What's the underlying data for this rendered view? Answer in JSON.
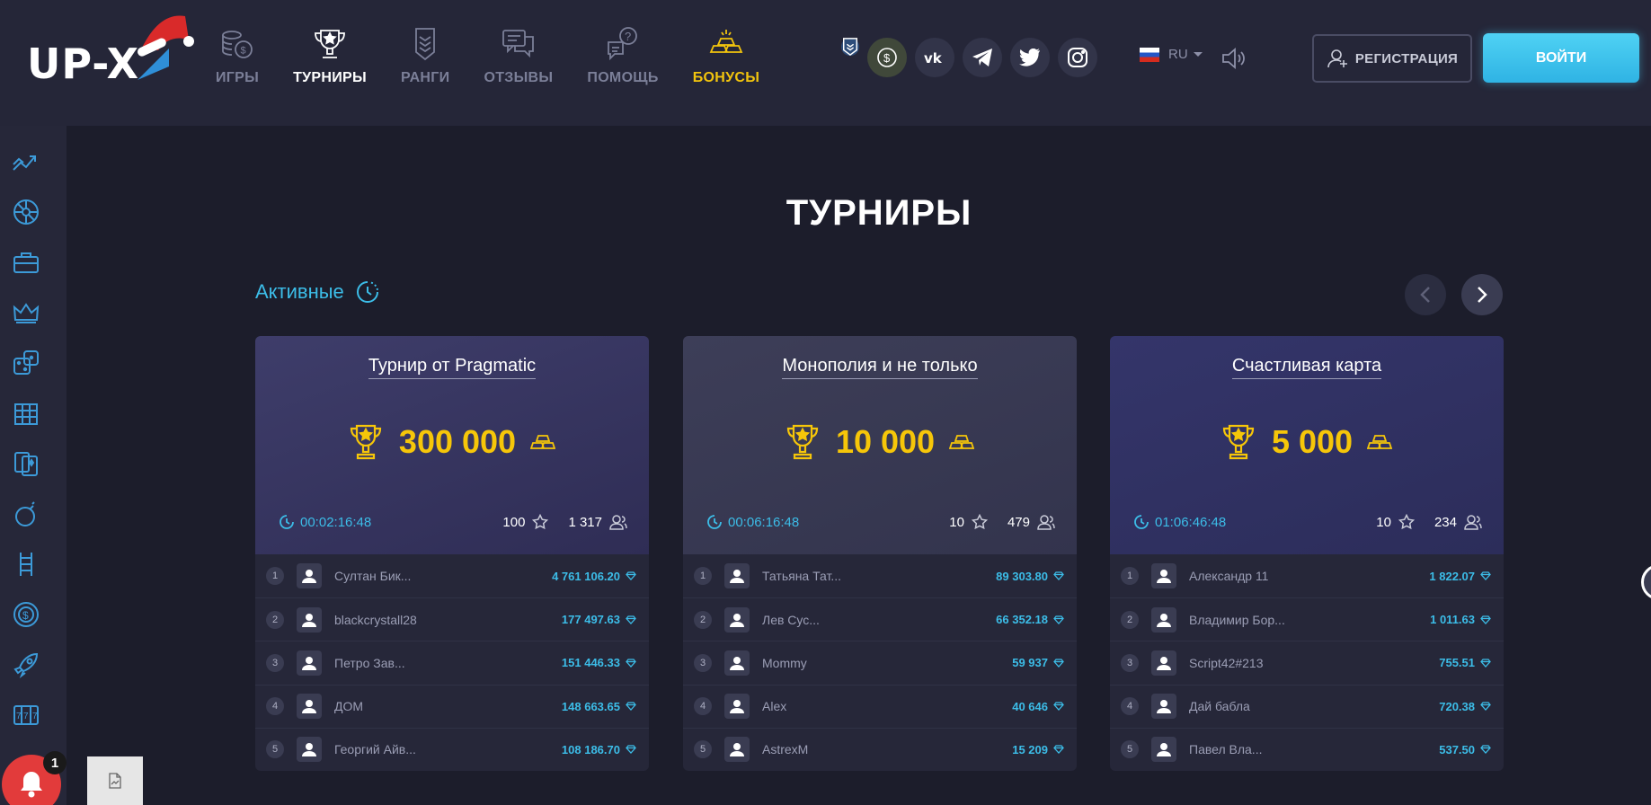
{
  "brand": {
    "logo_text": "UP-X"
  },
  "nav": [
    {
      "label": "ИГРЫ",
      "icon": "coins-icon"
    },
    {
      "label": "ТУРНИРЫ",
      "icon": "trophy-icon"
    },
    {
      "label": "РАНГИ",
      "icon": "rank-icon"
    },
    {
      "label": "ОТЗЫВЫ",
      "icon": "chat-icon"
    },
    {
      "label": "ПОМОЩЬ",
      "icon": "help-icon"
    },
    {
      "label": "БОНУСЫ",
      "icon": "gold-bars-icon"
    }
  ],
  "socials": [
    "rank-badge-icon",
    "coin-dollar-icon",
    "vk-icon",
    "telegram-icon",
    "twitter-icon",
    "instagram-icon"
  ],
  "language": {
    "current": "RU"
  },
  "auth": {
    "register_label": "РЕГИСТРАЦИЯ",
    "login_label": "ВОЙТИ"
  },
  "sidebar": [
    "trend-icon",
    "wheel-icon",
    "case-icon",
    "crown-icon",
    "dice-icon",
    "keno-icon",
    "cards-icon",
    "bomb-icon",
    "ladder-icon",
    "dollar-wheel-icon",
    "rocket-icon",
    "slots-icon"
  ],
  "page": {
    "title": "ТУРНИРЫ",
    "section_title": "Активные"
  },
  "colors": {
    "accent": "#3cbde8",
    "gold": "#f6c609",
    "login": "#2fb3e4",
    "bell": "#e23b3b"
  },
  "tournaments": [
    {
      "title": "Турнир от Pragmatic",
      "prize": "300 000",
      "timer": "00:02:16:48",
      "stars": "100",
      "participants": "1 317",
      "leaders": [
        {
          "rank": "1",
          "name": "Султан Бик...",
          "score": "4 761 106.20"
        },
        {
          "rank": "2",
          "name": "blackcrystall28",
          "score": "177 497.63"
        },
        {
          "rank": "3",
          "name": "Петро Зав...",
          "score": "151 446.33"
        },
        {
          "rank": "4",
          "name": "ДОМ",
          "score": "148 663.65"
        },
        {
          "rank": "5",
          "name": "Георгий Айв...",
          "score": "108 186.70"
        }
      ]
    },
    {
      "title": "Монополия и не только",
      "prize": "10 000",
      "timer": "00:06:16:48",
      "stars": "10",
      "participants": "479",
      "leaders": [
        {
          "rank": "1",
          "name": "Татьяна Тат...",
          "score": "89 303.80"
        },
        {
          "rank": "2",
          "name": "Лев Сус...",
          "score": "66 352.18"
        },
        {
          "rank": "3",
          "name": "Mommy",
          "score": "59 937"
        },
        {
          "rank": "4",
          "name": "Alex",
          "score": "40 646"
        },
        {
          "rank": "5",
          "name": "AstrexM",
          "score": "15 209"
        }
      ]
    },
    {
      "title": "Счастливая карта",
      "prize": "5 000",
      "timer": "01:06:46:48",
      "stars": "10",
      "participants": "234",
      "leaders": [
        {
          "rank": "1",
          "name": "Александр 11",
          "score": "1 822.07"
        },
        {
          "rank": "2",
          "name": "Владимир Бор...",
          "score": "1 011.63"
        },
        {
          "rank": "3",
          "name": "Script42#213",
          "score": "755.51"
        },
        {
          "rank": "4",
          "name": "Дай бабла",
          "score": "720.38"
        },
        {
          "rank": "5",
          "name": "Павел Вла...",
          "score": "537.50"
        }
      ]
    }
  ],
  "notifications": {
    "count": "1"
  }
}
